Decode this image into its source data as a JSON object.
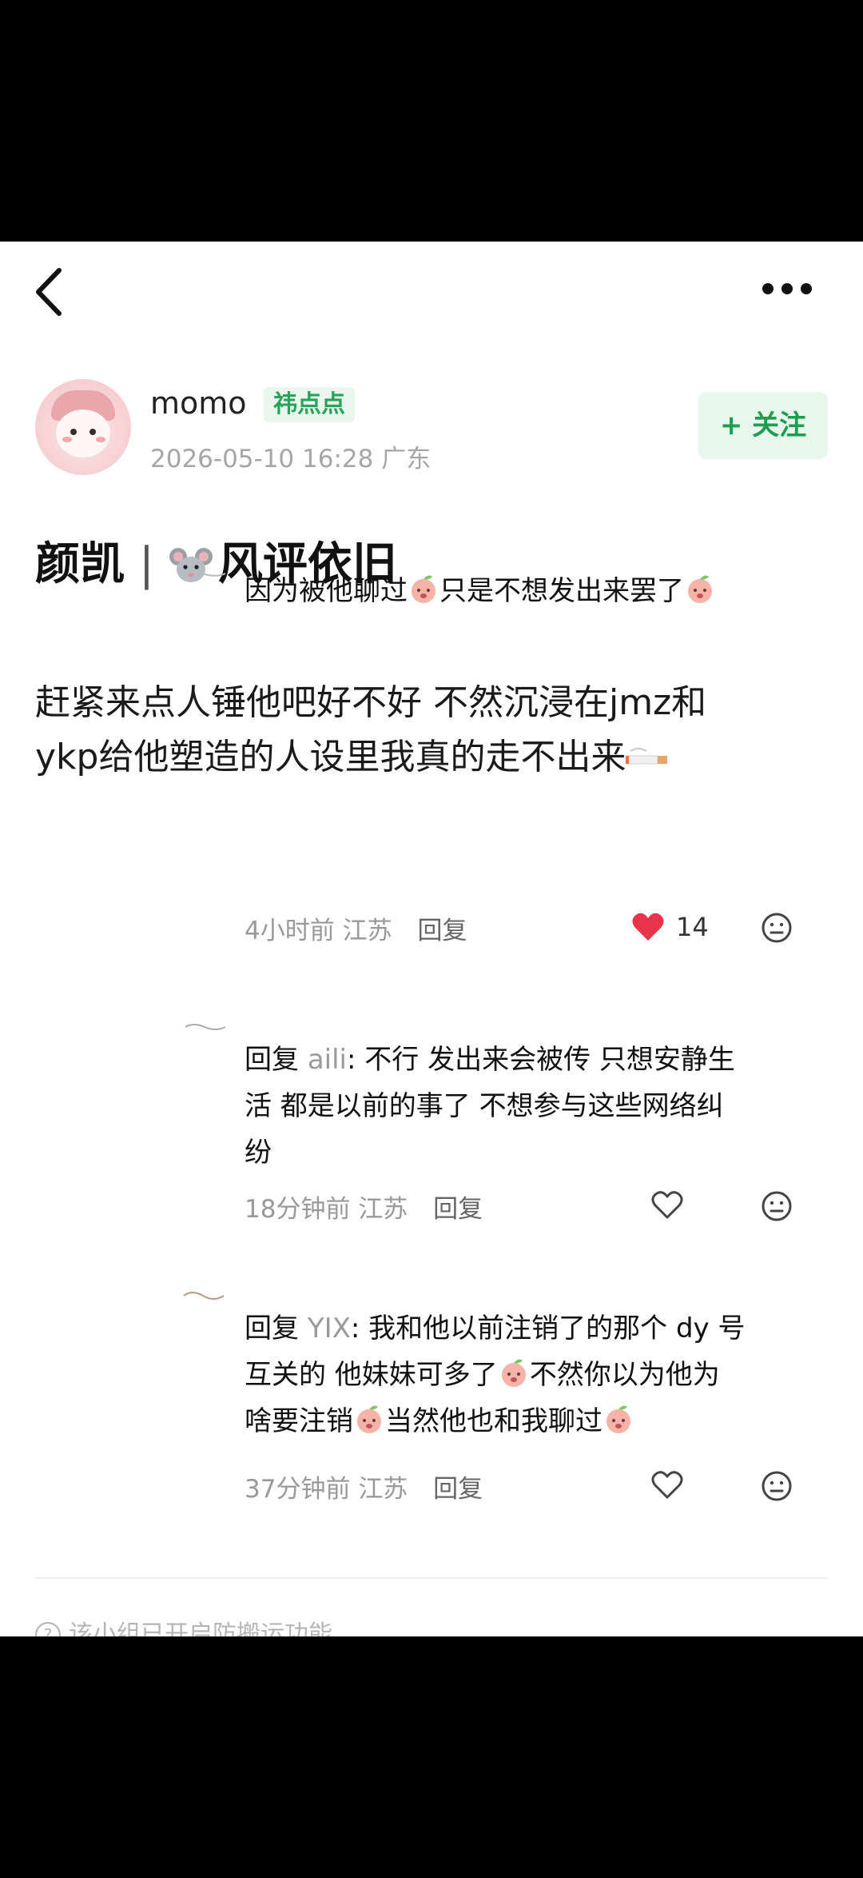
{
  "nav": {
    "back_icon": "chevron-left-icon",
    "more_icon": "more-horizontal-icon"
  },
  "author": {
    "name": "momo",
    "group_badge": "祎点点",
    "meta": "2026-05-10 16:28  广东",
    "follow_label": "+ 关注"
  },
  "post": {
    "title_left": "颜凯",
    "title_sep": "|",
    "title_right": "风评依旧",
    "body_line1": "赶紧来点人锤他吧好不好 不然沉浸在jmz和",
    "body_line2": "ykp给他塑造的人设里我真的走不出来"
  },
  "comments": [
    {
      "text_a": "因为被他聊过",
      "text_b": "只是不想发出来罢了",
      "time": "4小时前",
      "location": "江苏",
      "reply": "回复",
      "likes": "14",
      "liked": true
    },
    {
      "prefix": "回复",
      "reply_to": "aili",
      "line1": ": 不行 发出来会被传 只想安静生",
      "line2": "活 都是以前的事了 不想参与这些网络纠",
      "line3": "纷",
      "time": "18分钟前",
      "location": "江苏",
      "reply": "回复"
    },
    {
      "prefix": "回复",
      "reply_to": "YIX",
      "line1": ": 我和他以前注销了的那个 dy 号",
      "line2a": "互关的 他妹妹可多了",
      "line2b": "不然你以为他为",
      "line3a": "啥要注销",
      "line3b": "当然他也和我聊过",
      "time": "37分钟前",
      "location": "江苏",
      "reply": "回复"
    }
  ],
  "footer": {
    "notice": "该小组已开启防搬运功能"
  },
  "colors": {
    "accent_green": "#1f9d50",
    "like_red": "#e8334a",
    "meta_gray": "#999999"
  }
}
